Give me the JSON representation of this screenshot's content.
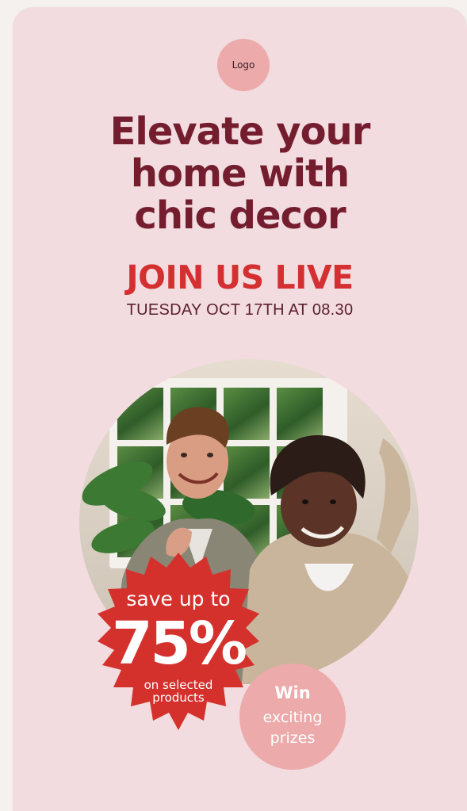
{
  "logo": {
    "label": "Logo"
  },
  "hero": {
    "headline": [
      "Elevate your",
      "home with",
      "chic decor"
    ],
    "event_title": "JOIN US LIVE",
    "event_date": "TUESDAY OCT 17TH AT 08.30"
  },
  "discount": {
    "line1": "save up to",
    "percent": "75%",
    "line3": "on selected",
    "line4": "products"
  },
  "prize": {
    "title": "Win",
    "line1": "exciting",
    "line2": "prizes"
  },
  "colors": {
    "background": "#f2dcdf",
    "headline": "#741d2f",
    "accent_red": "#d53031",
    "soft_pink": "#ecaaab"
  },
  "icons": {
    "badge_shape": "starburst-badge-icon"
  }
}
